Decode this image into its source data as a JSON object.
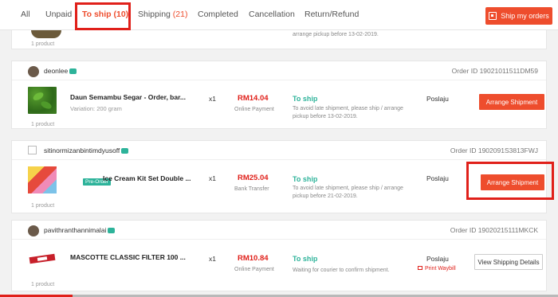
{
  "tabs": [
    {
      "label": "All",
      "count": ""
    },
    {
      "label": "Unpaid",
      "count": ""
    },
    {
      "label": "To ship",
      "count": "(10)"
    },
    {
      "label": "Shipping",
      "count": "(21)"
    },
    {
      "label": "Completed",
      "count": ""
    },
    {
      "label": "Cancellation",
      "count": ""
    },
    {
      "label": "Return/Refund",
      "count": ""
    }
  ],
  "header": {
    "ship_button": "Ship my orders",
    "icon": "list-icon"
  },
  "prev_order": {
    "product_count": "1 product",
    "note": "arrange pickup before 13-02-2019."
  },
  "orders": [
    {
      "username": "deonlee",
      "order_id": "Order ID 19021011511DM59",
      "product": "Daun Semambu Segar - Order, bar...",
      "variation": "Variation: 200 gram",
      "product_count": "1 product",
      "qty": "x1",
      "price": "RM14.04",
      "payment": "Online Payment",
      "status": "To ship",
      "note": "To avoid late shipment, please ship / arrange pickup before 13-02-2019.",
      "courier": "Poslaju",
      "action": "Arrange Shipment"
    },
    {
      "username": "sitinormizanbintimdyusoff",
      "order_id": "Order ID 1902091S3813FWJ",
      "badge": "Pre-Order",
      "product": "Ice Cream Kit Set Double ...",
      "product_count": "1 product",
      "qty": "x1",
      "price": "RM25.04",
      "payment": "Bank Transfer",
      "status": "To ship",
      "note": "To avoid late shipment, please ship / arrange pickup before 21-02-2019.",
      "courier": "Poslaju",
      "action": "Arrange Shipment"
    },
    {
      "username": "pavithranthannimalai",
      "order_id": "Order ID 19020215111MKCK",
      "product": "MASCOTTE CLASSIC FILTER 100 ...",
      "product_count": "1 product",
      "qty": "x1",
      "price": "RM10.84",
      "payment": "Online Payment",
      "status": "To ship",
      "note": "Waiting for courier to confirm shipment.",
      "courier": "Poslaju",
      "waybill": "Print Waybill",
      "action": "View Shipping Details"
    }
  ],
  "video": {
    "progress": 0.13
  },
  "colors": {
    "accent": "#ee4d2d",
    "status_green": "#2db39a",
    "annotation_red": "#e0201a"
  }
}
